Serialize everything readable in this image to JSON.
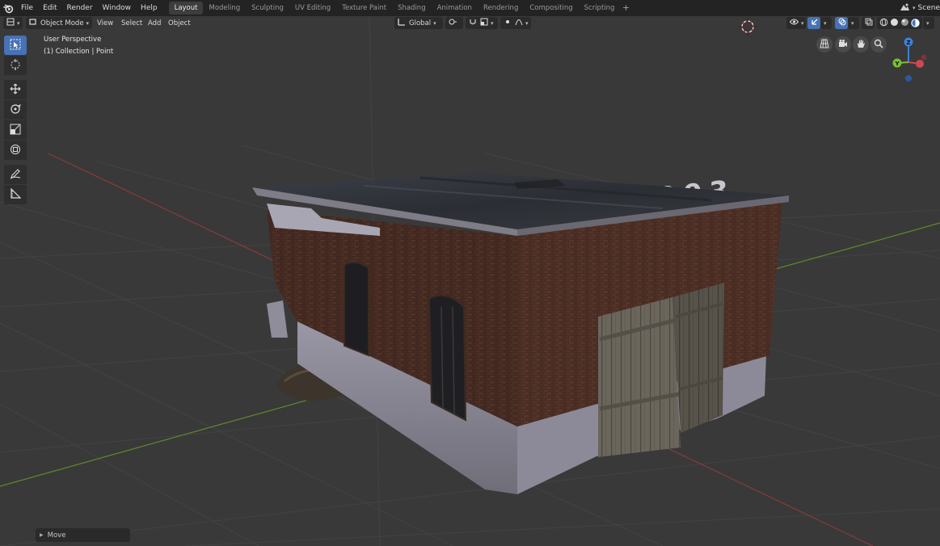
{
  "menu": {
    "items": [
      "File",
      "Edit",
      "Render",
      "Window",
      "Help"
    ]
  },
  "workspaces": {
    "tabs": [
      "Layout",
      "Modeling",
      "Sculpting",
      "UV Editing",
      "Texture Paint",
      "Shading",
      "Animation",
      "Rendering",
      "Compositing",
      "Scripting"
    ],
    "active": "Layout"
  },
  "scene": {
    "label": "Scene"
  },
  "viewport_header": {
    "mode": "Object Mode",
    "menus": [
      "View",
      "Select",
      "Add",
      "Object"
    ],
    "transform_orientation": "Global"
  },
  "overlay": {
    "view_name": "User Perspective",
    "collection_info": "(1) Collection | Point"
  },
  "building": {
    "year_text": "1993"
  },
  "last_operator": {
    "label": "Move"
  },
  "colors": {
    "accent": "#4772b3",
    "x_axis": "#d2474c",
    "y_axis": "#7bbf35",
    "z_axis": "#3a82d8"
  }
}
